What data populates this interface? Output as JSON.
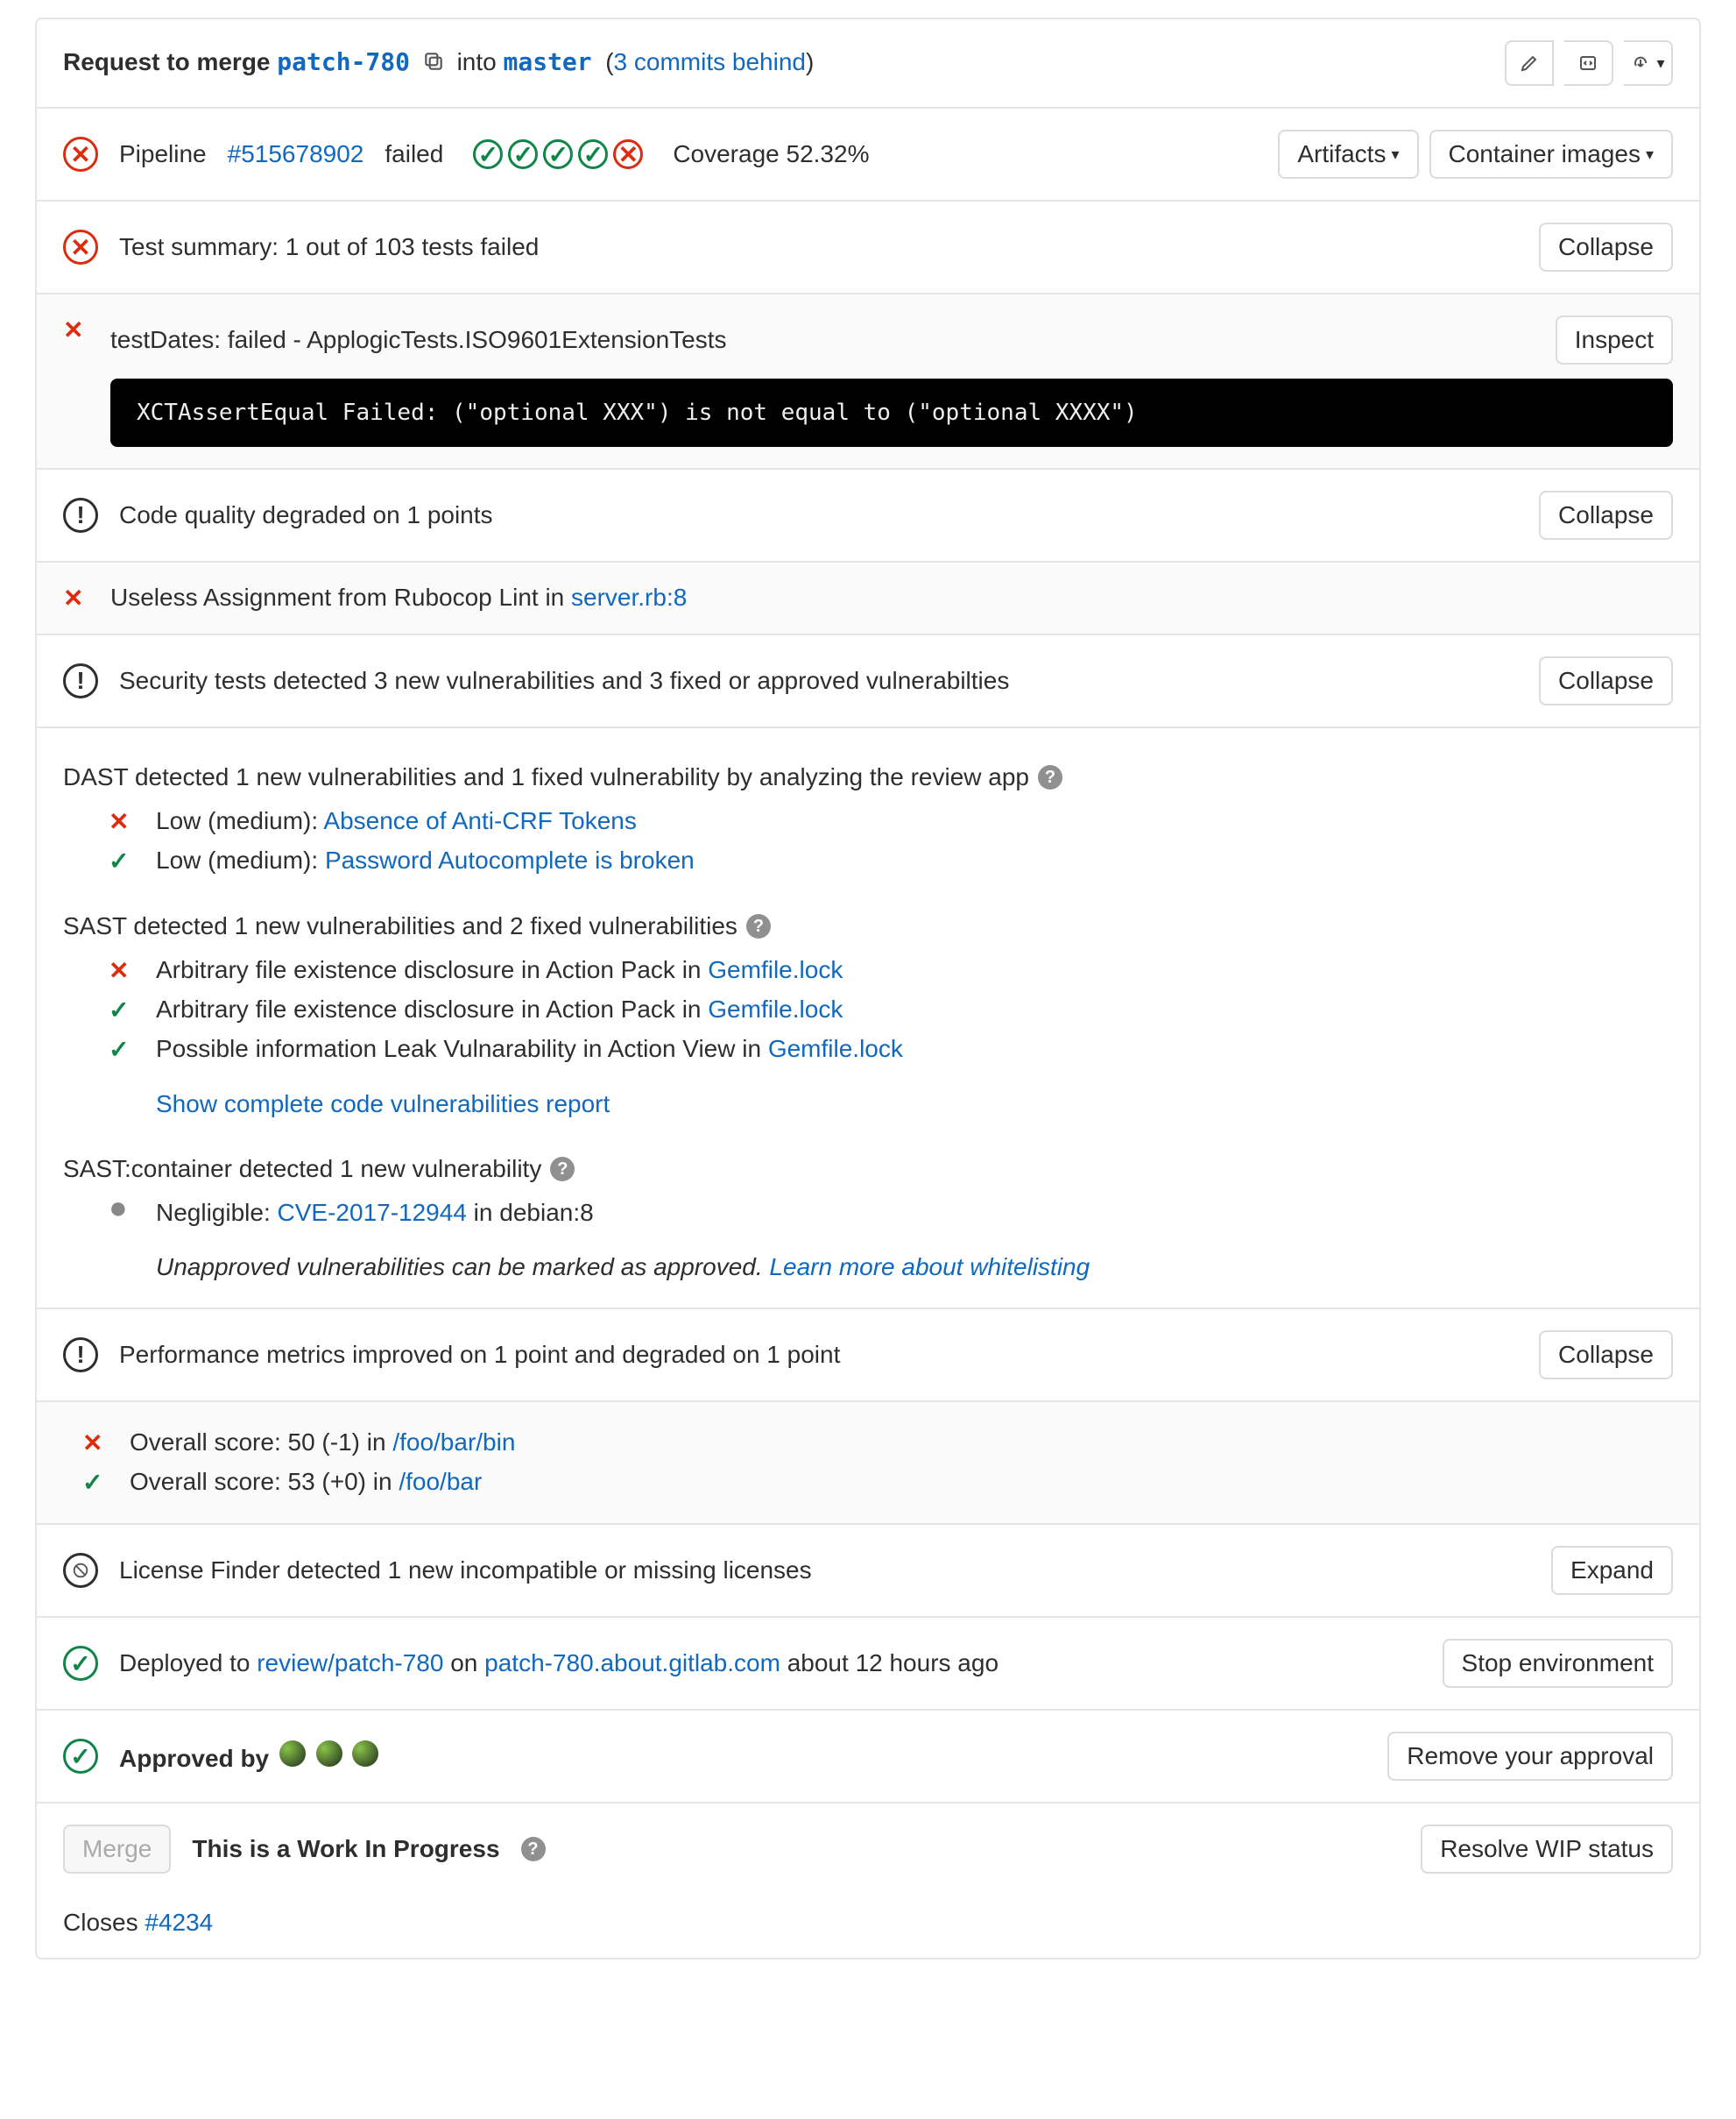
{
  "header": {
    "prefix": "Request to merge",
    "source_branch": "patch-780",
    "into": "into",
    "target_branch": "master",
    "behind_text": "3 commits behind"
  },
  "pipeline": {
    "label": "Pipeline",
    "id": "#515678902",
    "status": "failed",
    "stages": [
      "pass",
      "pass",
      "pass",
      "pass",
      "fail"
    ],
    "coverage_label": "Coverage 52.32%",
    "artifacts_btn": "Artifacts",
    "container_btn": "Container images"
  },
  "tests": {
    "summary": "Test summary: 1 out of 103 tests failed",
    "collapse": "Collapse",
    "fail_line": "testDates: failed - ApplogicTests.ISO9601ExtensionTests",
    "inspect": "Inspect",
    "trace": "XCTAssertEqual Failed: (\"optional XXX\") is not equal to (\"optional XXXX\")"
  },
  "code_quality": {
    "summary": "Code quality degraded on 1 points",
    "collapse": "Collapse",
    "item_prefix": "Useless Assignment from Rubocop Lint in ",
    "item_link": "server.rb:8"
  },
  "security": {
    "summary": "Security tests detected 3 new vulnerabilities and 3 fixed or approved vulnerabilties",
    "collapse": "Collapse",
    "dast_heading": "DAST detected 1 new vulnerabilities and 1 fixed vulnerability by analyzing the review app",
    "dast_items": [
      {
        "mark": "x",
        "prefix": "Low (medium): ",
        "link": "Absence of Anti-CRF Tokens"
      },
      {
        "mark": "v",
        "prefix": "Low (medium): ",
        "link": "Password Autocomplete is broken"
      }
    ],
    "sast_heading": "SAST detected 1 new vulnerabilities and 2 fixed vulnerabilities",
    "sast_items": [
      {
        "mark": "x",
        "prefix": "Arbitrary file existence disclosure in Action Pack in ",
        "link": "Gemfile.lock"
      },
      {
        "mark": "v",
        "prefix": "Arbitrary file existence disclosure in Action Pack in ",
        "link": "Gemfile.lock"
      },
      {
        "mark": "v",
        "prefix": "Possible information Leak Vulnarability in Action View in ",
        "link": "Gemfile.lock"
      }
    ],
    "show_all": "Show complete code vulnerabilities report",
    "container_heading": "SAST:container detected 1 new vulnerability",
    "container_items": [
      {
        "mark": "dot",
        "prefix": "Negligible: ",
        "link": "CVE-2017-12944",
        "suffix": " in debian:8"
      }
    ],
    "whitelist_prefix": "Unapproved vulnerabilities can be marked as approved. ",
    "whitelist_link": "Learn more about whitelisting"
  },
  "performance": {
    "summary": "Performance metrics improved on 1 point and degraded on 1 point",
    "collapse": "Collapse",
    "items": [
      {
        "mark": "x",
        "prefix": "Overall score: 50 (-1) in ",
        "link": "/foo/bar/bin"
      },
      {
        "mark": "v",
        "prefix": "Overall score: 53 (+0) in ",
        "link": "/foo/bar"
      }
    ]
  },
  "license": {
    "summary": "License Finder detected 1 new incompatible or missing licenses",
    "expand": "Expand"
  },
  "deploy": {
    "prefix": "Deployed to ",
    "env": "review/patch-780",
    "on": " on ",
    "url": "patch-780.about.gitlab.com",
    "ago": " about 12 hours ago",
    "stop": "Stop environment"
  },
  "approval": {
    "label": "Approved by",
    "remove": "Remove your approval"
  },
  "merge": {
    "button": "Merge",
    "wip": "This is a Work In Progress",
    "resolve": "Resolve WIP status"
  },
  "closes": {
    "prefix": "Closes ",
    "issue": "#4234"
  }
}
